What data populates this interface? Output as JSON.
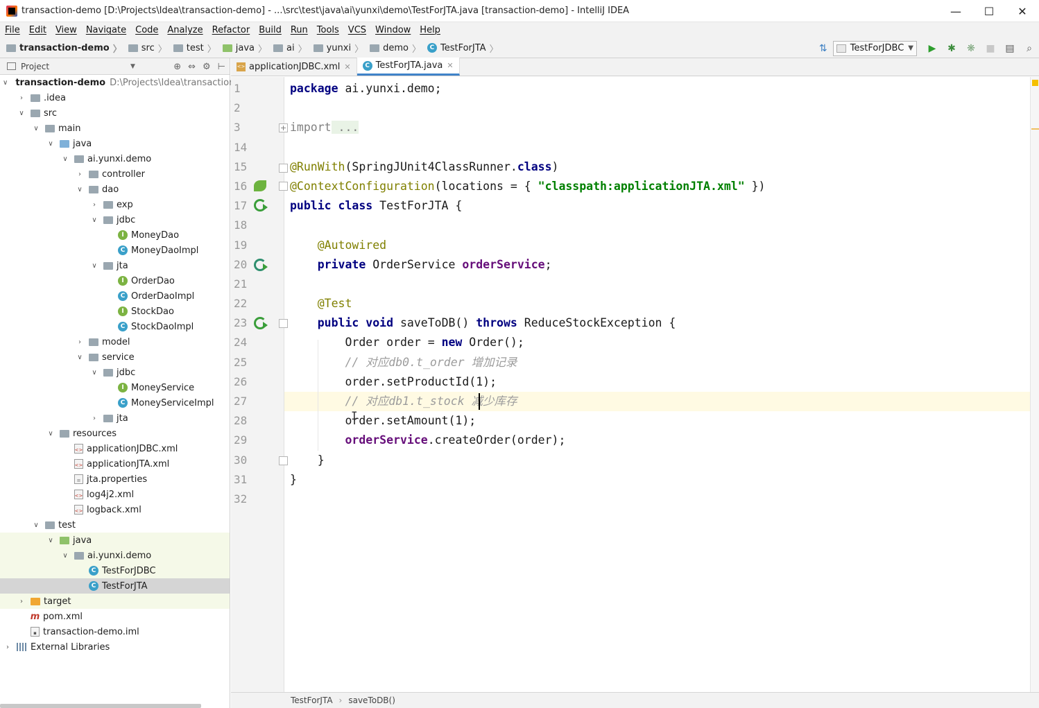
{
  "window": {
    "title": "transaction-demo [D:\\Projects\\Idea\\transaction-demo] - ...\\src\\test\\java\\ai\\yunxi\\demo\\TestForJTA.java [transaction-demo] - IntelliJ IDEA",
    "minimize": "—",
    "maximize": "☐",
    "close": "✕"
  },
  "menu": [
    "File",
    "Edit",
    "View",
    "Navigate",
    "Code",
    "Analyze",
    "Refactor",
    "Build",
    "Run",
    "Tools",
    "VCS",
    "Window",
    "Help"
  ],
  "breadcrumbs": [
    "transaction-demo",
    "src",
    "test",
    "java",
    "ai",
    "yunxi",
    "demo",
    "TestForJTA"
  ],
  "run_config": "TestForJDBC",
  "project_panel": {
    "title": "Project",
    "root_name": "transaction-demo",
    "root_path": "D:\\Projects\\Idea\\transaction",
    "tree": [
      ".idea",
      "src",
      "main",
      "java",
      "ai.yunxi.demo",
      "controller",
      "dao",
      "exp",
      "jdbc",
      "MoneyDao",
      "MoneyDaoImpl",
      "jta",
      "OrderDao",
      "OrderDaoImpl",
      "StockDao",
      "StockDaoImpl",
      "model",
      "service",
      "jdbc",
      "MoneyService",
      "MoneyServiceImpl",
      "jta",
      "resources",
      "applicationJDBC.xml",
      "applicationJTA.xml",
      "jta.properties",
      "log4j2.xml",
      "logback.xml",
      "test",
      "java",
      "ai.yunxi.demo",
      "TestForJDBC",
      "TestForJTA",
      "target",
      "pom.xml",
      "transaction-demo.iml",
      "External Libraries"
    ]
  },
  "editor": {
    "tabs": [
      {
        "label": "applicationJDBC.xml",
        "active": false
      },
      {
        "label": "TestForJTA.java",
        "active": true
      }
    ],
    "line_numbers": [
      "1",
      "2",
      "3",
      "14",
      "15",
      "16",
      "17",
      "18",
      "19",
      "20",
      "21",
      "22",
      "23",
      "24",
      "25",
      "26",
      "27",
      "28",
      "29",
      "30",
      "31",
      "32"
    ],
    "code": {
      "package_kw": "package",
      "package_name": " ai.yunxi.demo;",
      "import_kw": "import",
      "import_fold": " ...",
      "runwith_ann": "@RunWith",
      "runwith_args": "(SpringJUnit4ClassRunner.",
      "runwith_class_kw": "class",
      "runwith_close": ")",
      "ctxcfg_ann": "@ContextConfiguration",
      "ctxcfg_open": "(locations = { ",
      "ctxcfg_str": "\"classpath:applicationJTA.xml\"",
      "ctxcfg_close": " })",
      "class_kw": "public class",
      "class_name": " TestForJTA {",
      "autowired_ann": "@Autowired",
      "private_kw": "private",
      "field_type": " OrderService ",
      "field_name": "orderService",
      "field_end": ";",
      "test_ann": "@Test",
      "method_kw": "public void",
      "method_name": " saveToDB() ",
      "throws_kw": "throws",
      "method_exc": " ReduceStockException {",
      "l24_a": "Order order = ",
      "l24_new": "new",
      "l24_b": " Order();",
      "l25_comment": "// 对应db0.t_order 增加记录",
      "l26": "order.setProductId(1);",
      "l27_comment": "// 对应db1.t_stock 减少库存",
      "l28": "order.setAmount(1);",
      "l29_field": "orderService",
      "l29_rest": ".createOrder(order);",
      "l30": "}",
      "l31": "}"
    }
  },
  "footer": {
    "class": "TestForJTA",
    "method": "saveToDB()"
  },
  "colors": {
    "keyword": "#000080",
    "annotation": "#808000",
    "string": "#008000",
    "field": "#660e7a",
    "comment": "#9c9c9c",
    "current_line": "#fffae3",
    "tab_accent": "#4083c9"
  }
}
